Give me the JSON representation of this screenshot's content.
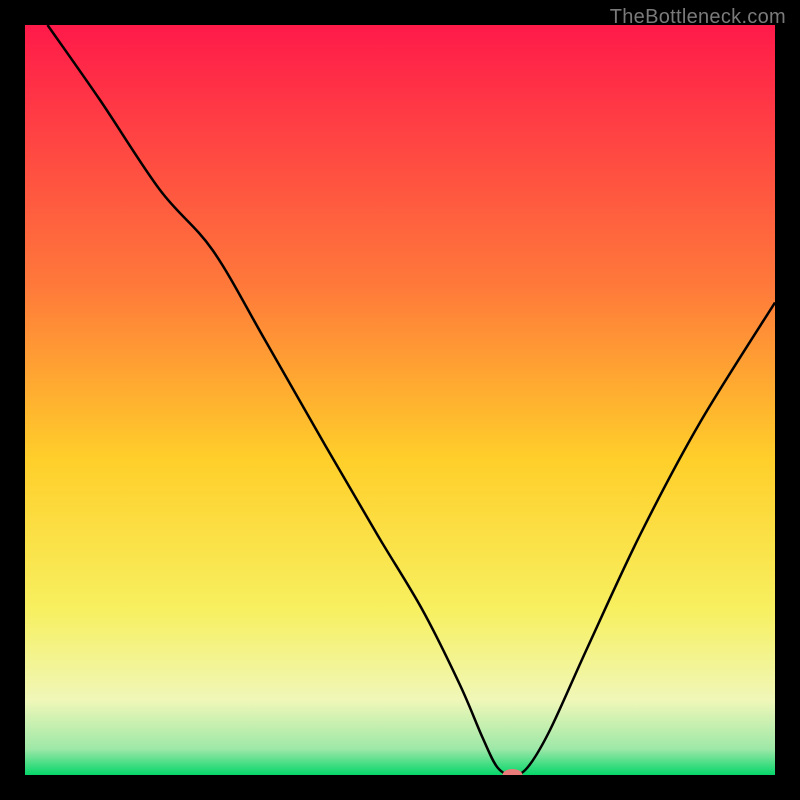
{
  "watermark": "TheBottleneck.com",
  "chart_data": {
    "type": "line",
    "title": "",
    "xlabel": "",
    "ylabel": "",
    "xlim": [
      0,
      100
    ],
    "ylim": [
      0,
      100
    ],
    "background_gradient": {
      "stops": [
        {
          "offset": 0.0,
          "color": "#ff1a4a"
        },
        {
          "offset": 0.35,
          "color": "#ff7a3a"
        },
        {
          "offset": 0.58,
          "color": "#ffcf2a"
        },
        {
          "offset": 0.78,
          "color": "#f7f060"
        },
        {
          "offset": 0.9,
          "color": "#f0f7b8"
        },
        {
          "offset": 0.965,
          "color": "#9ee8a8"
        },
        {
          "offset": 1.0,
          "color": "#05d66a"
        }
      ]
    },
    "curve": {
      "x": [
        3,
        10,
        18,
        25,
        32,
        40,
        47,
        53,
        58,
        61,
        63,
        65,
        67,
        70,
        75,
        82,
        90,
        100
      ],
      "y": [
        100,
        90,
        78,
        70,
        58,
        44,
        32,
        22,
        12,
        5,
        1,
        0,
        1,
        6,
        17,
        32,
        47,
        63
      ]
    },
    "marker": {
      "x": 65,
      "y": 0,
      "color": "#e97b7b",
      "rx": 10,
      "ry": 6
    }
  }
}
